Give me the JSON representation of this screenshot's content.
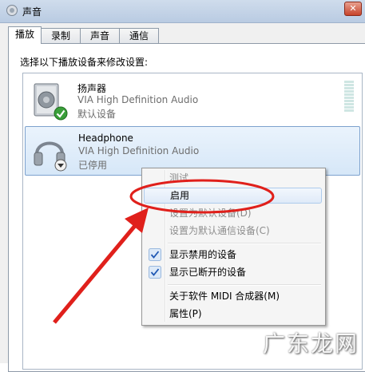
{
  "window": {
    "title": "声音",
    "close_label": "✕"
  },
  "tabs": [
    {
      "label": "播放",
      "active": true
    },
    {
      "label": "录制",
      "active": false
    },
    {
      "label": "声音",
      "active": false
    },
    {
      "label": "通信",
      "active": false
    }
  ],
  "instruction": "选择以下播放设备来修改设置:",
  "devices": [
    {
      "name": "扬声器",
      "driver": "VIA High Definition Audio",
      "status": "默认设备",
      "icon": "speaker-icon",
      "badge": "default-check-icon"
    },
    {
      "name": "Headphone",
      "driver": "VIA High Definition Audio",
      "status": "已停用",
      "icon": "headphone-icon",
      "badge": "disabled-arrow-icon",
      "selected": true
    }
  ],
  "context_menu": {
    "items": [
      {
        "label": "测试",
        "disabled": true
      },
      {
        "label": "启用",
        "disabled": false,
        "highlighted": true
      },
      {
        "label": "设置为默认设备(D)",
        "disabled": true
      },
      {
        "label": "设置为默认通信设备(C)",
        "disabled": true
      },
      {
        "label": "显示禁用的设备",
        "checked": true
      },
      {
        "label": "显示已断开的设备",
        "checked": true
      },
      {
        "label": "关于软件 MIDI 合成器(M)"
      },
      {
        "label": "属性(P)"
      }
    ]
  },
  "annotation": {
    "color": "#e0201b"
  },
  "watermark": "广东龙网"
}
